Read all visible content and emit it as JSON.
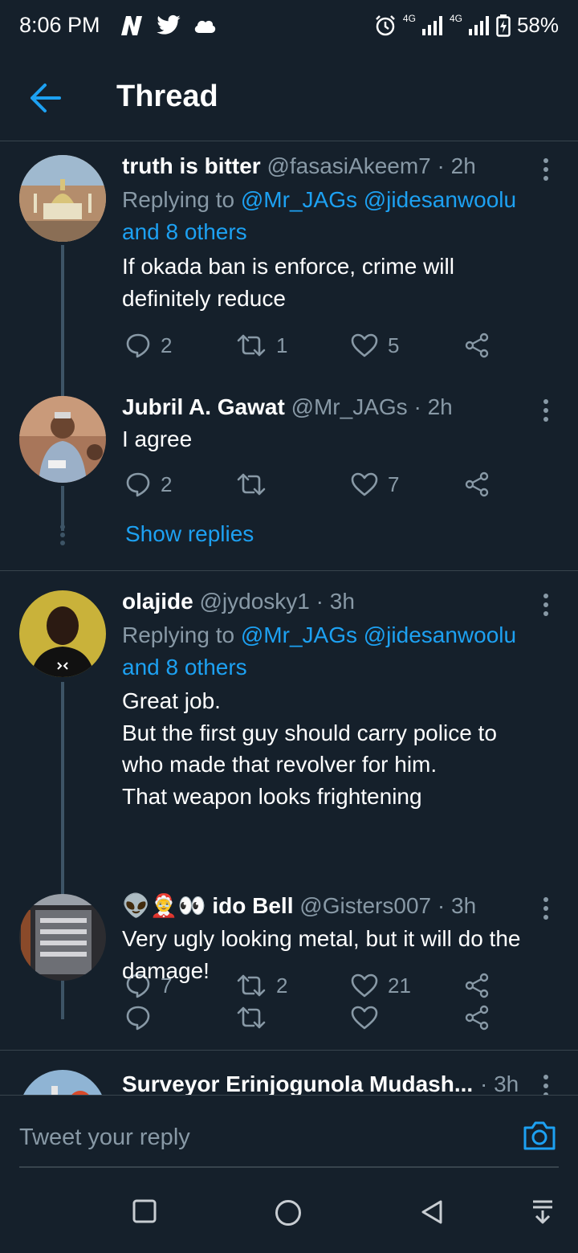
{
  "status_bar": {
    "time": "8:06 PM",
    "battery": "58%",
    "network_labels": [
      "4G",
      "4G"
    ]
  },
  "header": {
    "title": "Thread"
  },
  "tweets": [
    {
      "name": "truth is bitter",
      "handle": "@fasasiAkeem7",
      "separator": "·",
      "time": "2h",
      "replying_prefix": "Replying to",
      "replying_mentions": "@Mr_JAGs @jidesanwoolu",
      "replying_and": "and 8 others",
      "text_lines": [
        "If okada ban is enforce, crime will",
        "definitely reduce"
      ],
      "replies": "2",
      "retweets": "1",
      "likes": "5"
    },
    {
      "name": "Jubril A. Gawat",
      "handle": "@Mr_JAGs",
      "separator": "·",
      "time": "2h",
      "text_lines": [
        "I agree"
      ],
      "replies": "2",
      "retweets": "",
      "likes": "7"
    },
    {
      "name": "olajide",
      "handle": "@jydosky1",
      "separator": "·",
      "time": "3h",
      "replying_prefix": "Replying to",
      "replying_mentions": "@Mr_JAGs @jidesanwoolu",
      "replying_and": "and 8 others",
      "text_lines": [
        "Great job.",
        "But the first guy should carry police to",
        "who made that revolver for him.",
        "That weapon looks frightening"
      ],
      "replies": "7",
      "retweets": "2",
      "likes": "21"
    },
    {
      "name_emoji": "👽🤶👀",
      "name": "ido Bell",
      "handle": "@Gisters007",
      "separator": "·",
      "time": "3h",
      "text_lines": [
        "Very ugly looking metal, but it will do the",
        "damage!"
      ],
      "replies": "",
      "retweets": "",
      "likes": ""
    },
    {
      "name": "Surveyor Erinjogunola Mudash...",
      "separator": "·",
      "time": "3h"
    }
  ],
  "show_replies": "Show replies",
  "reply_box": {
    "placeholder": "Tweet your reply"
  },
  "colors": {
    "background": "#15202b",
    "accent": "#1da1f2",
    "secondary_text": "#8899a6",
    "divider": "#38444d"
  }
}
